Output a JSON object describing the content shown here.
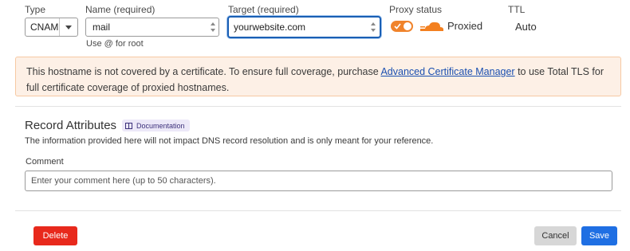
{
  "form": {
    "type_label": "Type",
    "type_value": "CNAME",
    "name_label": "Name (required)",
    "name_value": "mail",
    "name_hint": "Use @ for root",
    "target_label": "Target (required)",
    "target_value": "yourwebsite.com",
    "proxy_label": "Proxy status",
    "proxy_value": "Proxied",
    "proxy_on": true,
    "ttl_label": "TTL",
    "ttl_value": "Auto"
  },
  "banner": {
    "text_before": "This hostname is not covered by a certificate. To ensure full coverage, purchase ",
    "link_text": "Advanced Certificate Manager",
    "text_after": " to use Total TLS for full certificate coverage of proxied hostnames."
  },
  "record_attributes": {
    "title": "Record Attributes",
    "doc_badge": "Documentation",
    "description": "The information provided here will not impact DNS record resolution and is only meant for your reference.",
    "comment_label": "Comment",
    "comment_placeholder": "Enter your comment here (up to 50 characters)."
  },
  "actions": {
    "delete_label": "Delete",
    "cancel_label": "Cancel",
    "save_label": "Save"
  },
  "colors": {
    "accent_blue": "#1f6fe3",
    "proxy_orange": "#f0832b",
    "delete_red": "#e8291c",
    "banner_bg": "#fdf0e6"
  }
}
